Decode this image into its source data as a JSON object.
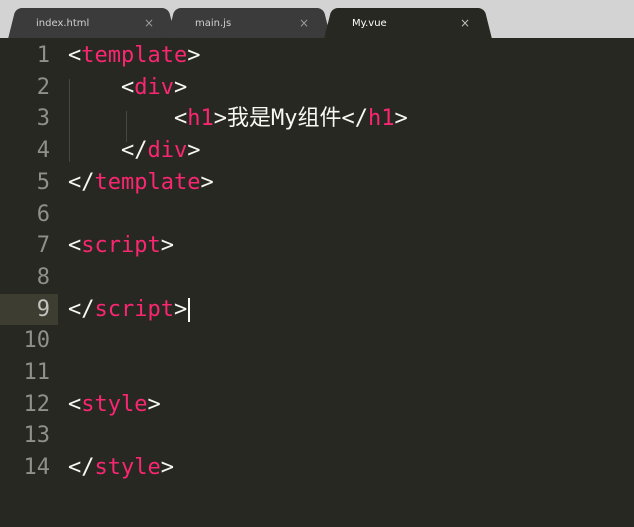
{
  "tabs": [
    {
      "label": "index.html",
      "close": "×",
      "active": false
    },
    {
      "label": "main.js",
      "close": "×",
      "active": false
    },
    {
      "label": "My.vue",
      "close": "×",
      "active": true
    }
  ],
  "colors": {
    "background": "#272822",
    "tag": "#f92672",
    "text": "#f8f8f2",
    "gutter": "#8f908a",
    "current_line_gutter": "#3e3d32"
  },
  "editor": {
    "current_line": 9,
    "lines": [
      {
        "num": "1",
        "indent": "",
        "open": "<",
        "tag": "template",
        "close": ">",
        "text": "",
        "open2": "",
        "tag2": "",
        "close2": ""
      },
      {
        "num": "2",
        "indent": "    ",
        "open": "<",
        "tag": "div",
        "close": ">",
        "text": "",
        "open2": "",
        "tag2": "",
        "close2": ""
      },
      {
        "num": "3",
        "indent": "        ",
        "open": "<",
        "tag": "h1",
        "close": ">",
        "text": "我是My组件",
        "open2": "</",
        "tag2": "h1",
        "close2": ">"
      },
      {
        "num": "4",
        "indent": "    ",
        "open": "</",
        "tag": "div",
        "close": ">",
        "text": "",
        "open2": "",
        "tag2": "",
        "close2": ""
      },
      {
        "num": "5",
        "indent": "",
        "open": "</",
        "tag": "template",
        "close": ">",
        "text": "",
        "open2": "",
        "tag2": "",
        "close2": ""
      },
      {
        "num": "6",
        "indent": "",
        "open": "",
        "tag": "",
        "close": "",
        "text": "",
        "open2": "",
        "tag2": "",
        "close2": ""
      },
      {
        "num": "7",
        "indent": "",
        "open": "<",
        "tag": "script",
        "close": ">",
        "text": "",
        "open2": "",
        "tag2": "",
        "close2": ""
      },
      {
        "num": "8",
        "indent": "",
        "open": "",
        "tag": "",
        "close": "",
        "text": "",
        "open2": "",
        "tag2": "",
        "close2": ""
      },
      {
        "num": "9",
        "indent": "",
        "open": "</",
        "tag": "script",
        "close": ">",
        "text": "",
        "open2": "",
        "tag2": "",
        "close2": ""
      },
      {
        "num": "10",
        "indent": "",
        "open": "",
        "tag": "",
        "close": "",
        "text": "",
        "open2": "",
        "tag2": "",
        "close2": ""
      },
      {
        "num": "11",
        "indent": "",
        "open": "",
        "tag": "",
        "close": "",
        "text": "",
        "open2": "",
        "tag2": "",
        "close2": ""
      },
      {
        "num": "12",
        "indent": "",
        "open": "<",
        "tag": "style",
        "close": ">",
        "text": "",
        "open2": "",
        "tag2": "",
        "close2": ""
      },
      {
        "num": "13",
        "indent": "",
        "open": "",
        "tag": "",
        "close": "",
        "text": "",
        "open2": "",
        "tag2": "",
        "close2": ""
      },
      {
        "num": "14",
        "indent": "",
        "open": "</",
        "tag": "style",
        "close": ">",
        "text": "",
        "open2": "",
        "tag2": "",
        "close2": ""
      }
    ]
  }
}
